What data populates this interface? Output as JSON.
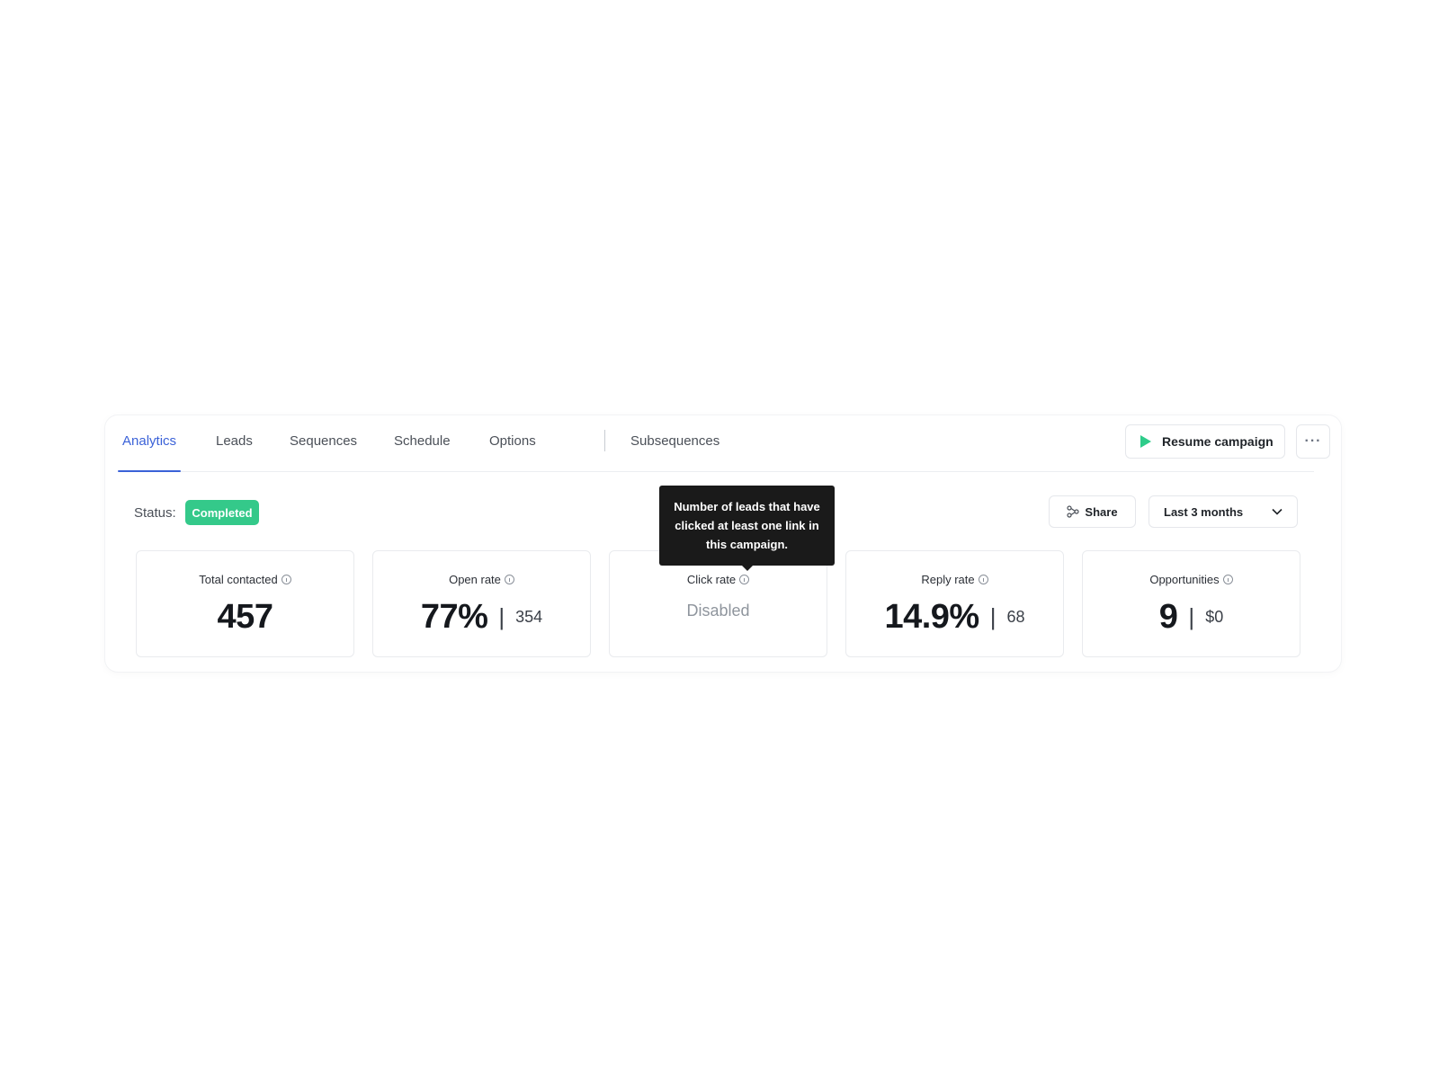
{
  "tabs": [
    {
      "label": "Analytics",
      "active": true
    },
    {
      "label": "Leads"
    },
    {
      "label": "Sequences"
    },
    {
      "label": "Schedule"
    },
    {
      "label": "Options"
    },
    {
      "label": "Subsequences"
    }
  ],
  "actions": {
    "resume_label": "Resume campaign",
    "more_label": "···"
  },
  "status": {
    "label": "Status:",
    "value": "Completed"
  },
  "toolbar": {
    "share_label": "Share",
    "range_label": "Last 3 months"
  },
  "tooltip": {
    "text": "Number of leads that have clicked at least one link in this campaign."
  },
  "metrics": {
    "total_contacted": {
      "label": "Total contacted",
      "value": "457"
    },
    "open_rate": {
      "label": "Open rate",
      "value": "77%",
      "secondary": "354"
    },
    "click_rate": {
      "label": "Click rate",
      "value": "Disabled"
    },
    "reply_rate": {
      "label": "Reply rate",
      "value": "14.9%",
      "secondary": "68"
    },
    "opportunities": {
      "label": "Opportunities",
      "value": "9",
      "secondary": "$0"
    }
  },
  "colors": {
    "accent": "#3b62d8",
    "success": "#34c98a",
    "play": "#2ecc8a",
    "tooltip_bg": "#1a1a1a"
  },
  "icons": [
    "play-icon",
    "more-icon",
    "share-icon",
    "chevron-down-icon",
    "info-icon"
  ]
}
